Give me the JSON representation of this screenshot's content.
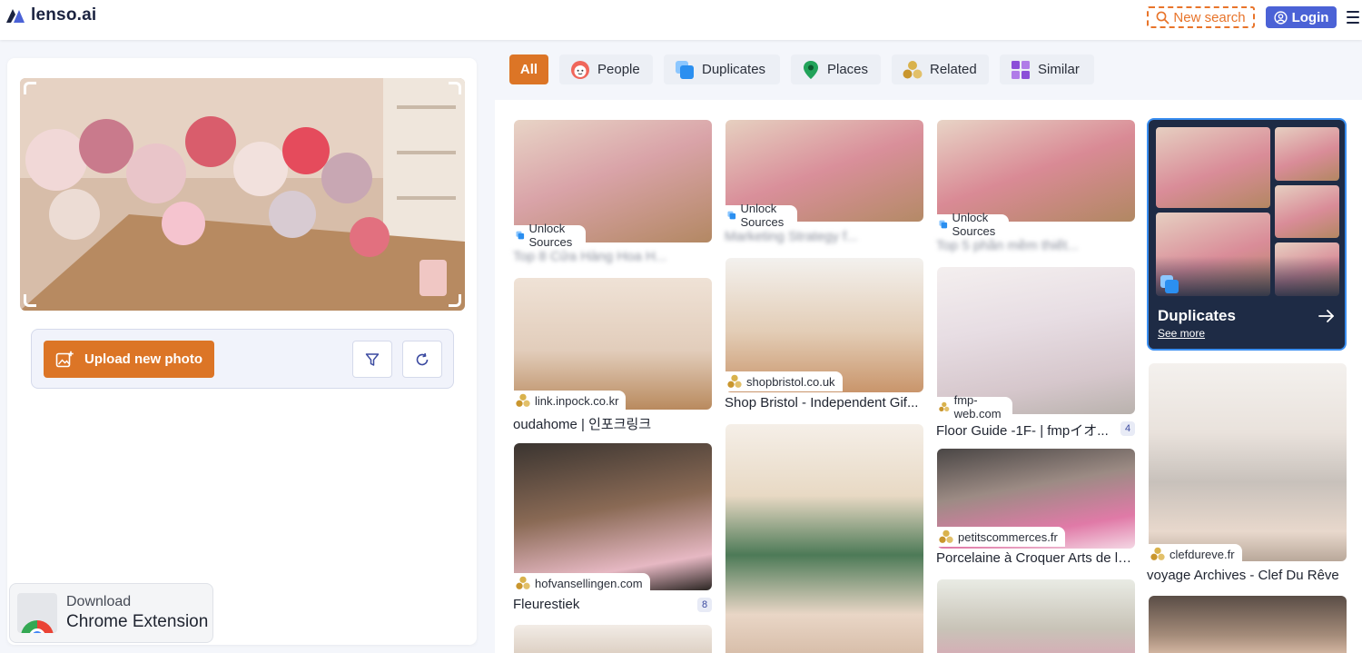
{
  "header": {
    "logo_text": "lenso.ai",
    "new_search_label": "New search",
    "login_label": "Login"
  },
  "left_panel": {
    "upload_label": "Upload new photo",
    "extension": {
      "line1": "Download",
      "line2": "Chrome Extension"
    }
  },
  "tabs": [
    {
      "label": "All",
      "icon": "all",
      "active": true
    },
    {
      "label": "People",
      "icon": "face-icon"
    },
    {
      "label": "Duplicates",
      "icon": "duplicates-icon"
    },
    {
      "label": "Places",
      "icon": "map-pin-icon"
    },
    {
      "label": "Related",
      "icon": "related-icon"
    },
    {
      "label": "Similar",
      "icon": "grid-icon"
    }
  ],
  "results": {
    "col1": [
      {
        "source": "Unlock Sources",
        "title": "Top 8 Cửa Hàng Hoa H...",
        "locked": true
      },
      {
        "source": "link.inpock.co.kr",
        "title": "oudahome | 인포크링크"
      },
      {
        "source": "hofvansellingen.com",
        "title": "Fleurestiek",
        "count": "8"
      }
    ],
    "col2": [
      {
        "source": "Unlock Sources",
        "title": "Marketing Strategy f...",
        "locked": true
      },
      {
        "source": "shopbristol.co.uk",
        "title": "Shop Bristol - Independent Gif..."
      }
    ],
    "col3": [
      {
        "source": "Unlock Sources",
        "title": "Top 5 phần mềm thiết...",
        "locked": true
      },
      {
        "source": "fmp-web.com",
        "title": "Floor Guide -1F- | fmpイオ...",
        "count": "4"
      },
      {
        "source": "petitscommerces.fr",
        "title": "Porcelaine à Croquer Arts de la..."
      }
    ],
    "col4": [
      {
        "source": "clefdureve.fr",
        "title": "voyage Archives - Clef Du Rêve"
      }
    ],
    "duplicates_card": {
      "title": "Duplicates",
      "see_more": "See more"
    }
  },
  "colors": {
    "accent": "#dc7526",
    "login": "#4b62d6",
    "duplicates_card": "#1e2b45"
  }
}
